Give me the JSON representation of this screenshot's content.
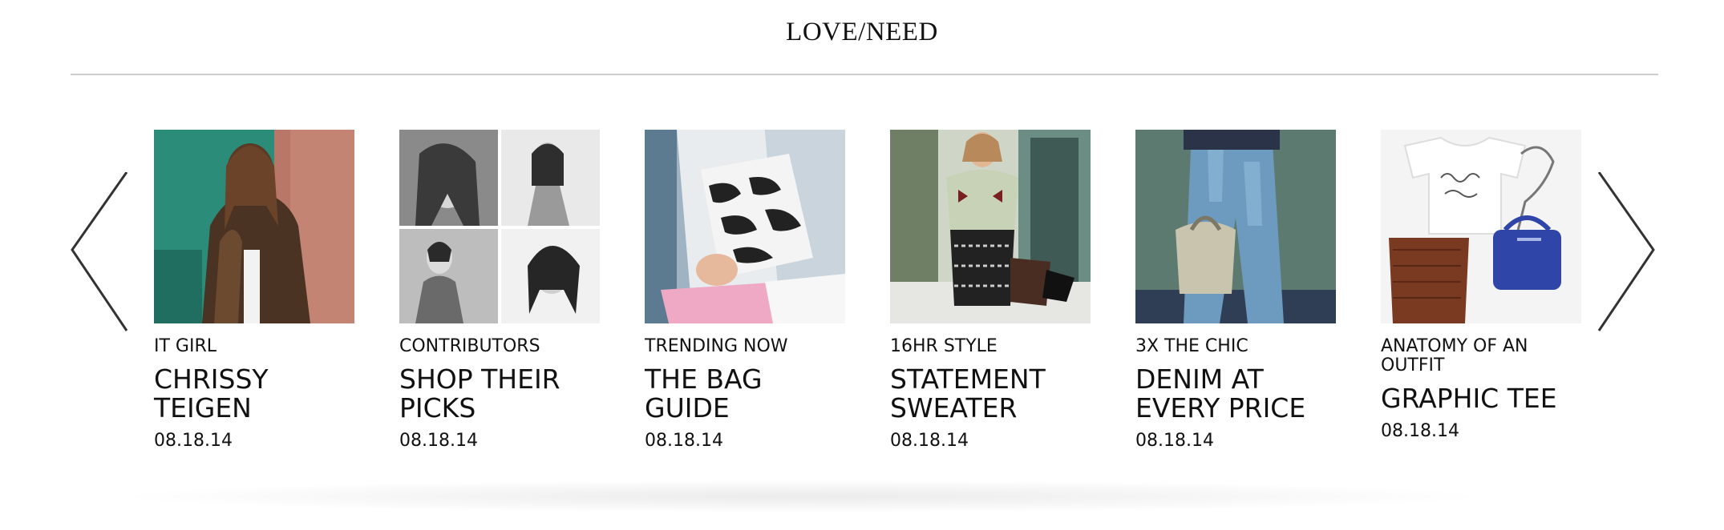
{
  "section": {
    "title": "LOVE/NEED"
  },
  "carousel": {
    "prev_icon": "chevron-left-icon",
    "next_icon": "chevron-right-icon",
    "items": [
      {
        "category": "IT GIRL",
        "headline": "CHRISSY TEIGEN",
        "date": "08.18.14",
        "image": "portrait-leopard-jacket"
      },
      {
        "category": "CONTRIBUTORS",
        "headline": "SHOP THEIR PICKS",
        "date": "08.18.14",
        "image": "contributors-bw-collage"
      },
      {
        "category": "TRENDING NOW",
        "headline": "THE BAG GUIDE",
        "date": "08.18.14",
        "image": "printed-clutch"
      },
      {
        "category": "16HR STYLE",
        "headline": "STATEMENT SWEATER",
        "date": "08.18.14",
        "image": "street-style-sweater"
      },
      {
        "category": "3X THE CHIC",
        "headline": "DENIM AT EVERY PRICE",
        "date": "08.18.14",
        "image": "denim-and-bag"
      },
      {
        "category": "ANATOMY OF AN OUTFIT",
        "headline": "GRAPHIC TEE",
        "date": "08.18.14",
        "image": "flatlay-always-late-tee"
      }
    ]
  }
}
